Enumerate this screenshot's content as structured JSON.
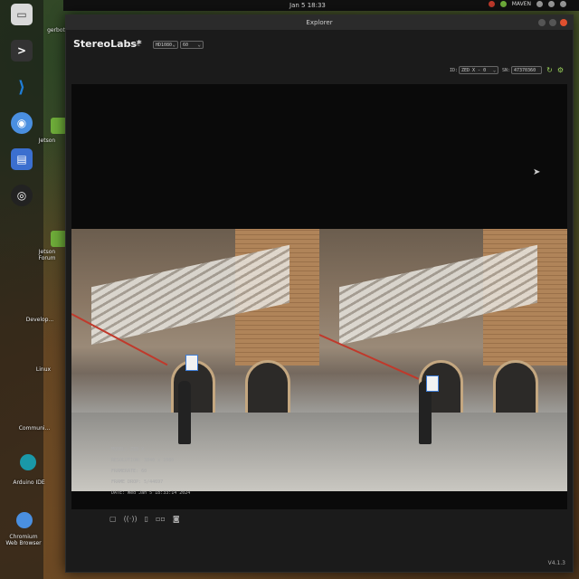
{
  "topbar": {
    "clock": "Jan 5 18:33",
    "tray_label": "MAVEN"
  },
  "dock": {
    "items": [
      {
        "name": "files-icon",
        "glyph": "▭",
        "color": "#d9d9d9"
      },
      {
        "name": "terminal-icon",
        "glyph": ">_",
        "color": "#333333"
      },
      {
        "name": "vscode-icon",
        "glyph": "⟩",
        "color": "#1f7dd6"
      },
      {
        "name": "chromium-icon",
        "glyph": "◉",
        "color": "#4a8fe0"
      },
      {
        "name": "docs-icon",
        "glyph": "▤",
        "color": "#3b6fcf"
      },
      {
        "name": "obs-icon",
        "glyph": "◎",
        "color": "#222222"
      }
    ]
  },
  "desktop": {
    "labels": {
      "jetson": "Jetson",
      "jetson_forum": "Jetson Forum",
      "developer": "Develop...",
      "linux": "Linux",
      "community": "Communi...",
      "arduino": "Arduino IDE",
      "chromium": "Chromium Web Browser",
      "gerbo": "gerbot"
    }
  },
  "window": {
    "title": "Explorer",
    "app_title": "StereoLabs*",
    "live_label": "LIVE",
    "resolution_select": "HD1080",
    "fps_select": "60",
    "id_label": "ID:",
    "id_select": "ZED X - 0",
    "sn_label": "SN:",
    "sn_value": "47370360",
    "meta": {
      "model": "MODEL: ZED X",
      "resolution": "RESOLUTION: 3840 x 1080",
      "framerate": "FRAMERATE: 60",
      "frame_drop": "FRAME DROP: 5/44697",
      "date": "DATE: Wed Jan 5 18:33:14 2024"
    },
    "version": "V4.1.3",
    "toolbar": [
      {
        "name": "folder-icon",
        "glyph": "▢"
      },
      {
        "name": "record-icon",
        "glyph": "((·))"
      },
      {
        "name": "svo-icon",
        "glyph": "▯"
      },
      {
        "name": "stereo-icon",
        "glyph": "▫▫"
      },
      {
        "name": "snapshot-icon",
        "glyph": "◙"
      }
    ]
  },
  "colors": {
    "accent": "#9ad25a",
    "close": "#e0502f"
  }
}
